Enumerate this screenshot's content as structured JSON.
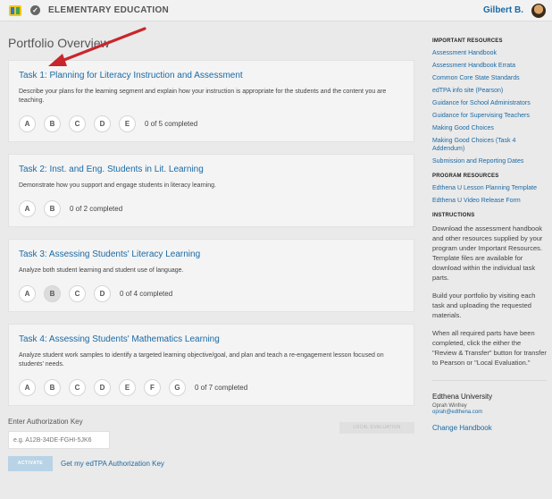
{
  "header": {
    "title": "ELEMENTARY EDUCATION",
    "user": "Gilbert B."
  },
  "page_title": "Portfolio Overview",
  "tasks": [
    {
      "title": "Task 1: Planning for Literacy Instruction and Assessment",
      "desc": "Describe your plans for the learning segment and explain how your instruction is appropriate for the students and the content you are teaching.",
      "parts": [
        "A",
        "B",
        "C",
        "D",
        "E"
      ],
      "progress": "0 of 5 completed"
    },
    {
      "title": "Task 2: Inst. and Eng. Students in Lit. Learning",
      "desc": "Demonstrate how you support and engage students in literacy learning.",
      "parts": [
        "A",
        "B"
      ],
      "progress": "0 of 2 completed"
    },
    {
      "title": "Task 3: Assessing Students' Literacy Learning",
      "desc": "Analyze both student learning and student use of language.",
      "parts": [
        "A",
        "B",
        "C",
        "D"
      ],
      "progress": "0 of 4 completed"
    },
    {
      "title": "Task 4: Assessing Students' Mathematics Learning",
      "desc": "Analyze student work samples to identify a targeted learning objective/goal, and plan and teach a re-engagement lesson focused on students' needs.",
      "parts": [
        "A",
        "B",
        "C",
        "D",
        "E",
        "F",
        "G"
      ],
      "progress": "0 of 7 completed"
    }
  ],
  "auth": {
    "label": "Enter Authorization Key",
    "placeholder": "e.g. A12B-34DE-FGHI-5JK6",
    "local_eval": "LOCAL EVALUATION",
    "activate": "ACTIVATE",
    "get_key": "Get my edTPA Authorization Key"
  },
  "sidebar": {
    "important_head": "IMPORTANT RESOURCES",
    "important": [
      "Assessment Handbook",
      "Assessment Handbook Errata",
      "Common Core State Standards",
      "edTPA info site (Pearson)",
      "Guidance for School Administrators",
      "Guidance for Supervising Teachers",
      "Making Good Choices",
      "Making Good Choices (Task 4 Addendum)",
      "Submission and Reporting Dates"
    ],
    "program_head": "PROGRAM RESOURCES",
    "program": [
      "Edthena U Lesson Planning Template",
      "Edthena U Video Release Form"
    ],
    "instr_head": "INSTRUCTIONS",
    "instructions": [
      "Download the assessment handbook and other resources supplied by your program under Important Resources. Template files are available for download within the individual task parts.",
      "Build your portfolio by visiting each task and uploading the requested materials.",
      "When all required parts have been completed, click the either the \"Review & Transfer\" button for transfer to Pearson or \"Local Evaluation.\""
    ],
    "org": "Edthena University",
    "contact": "Oprah Winfrey",
    "email": "oprah@edthena.com",
    "change": "Change Handbook"
  },
  "colors": {
    "accent": "#1a6aa5",
    "arrow": "#c9252c"
  }
}
